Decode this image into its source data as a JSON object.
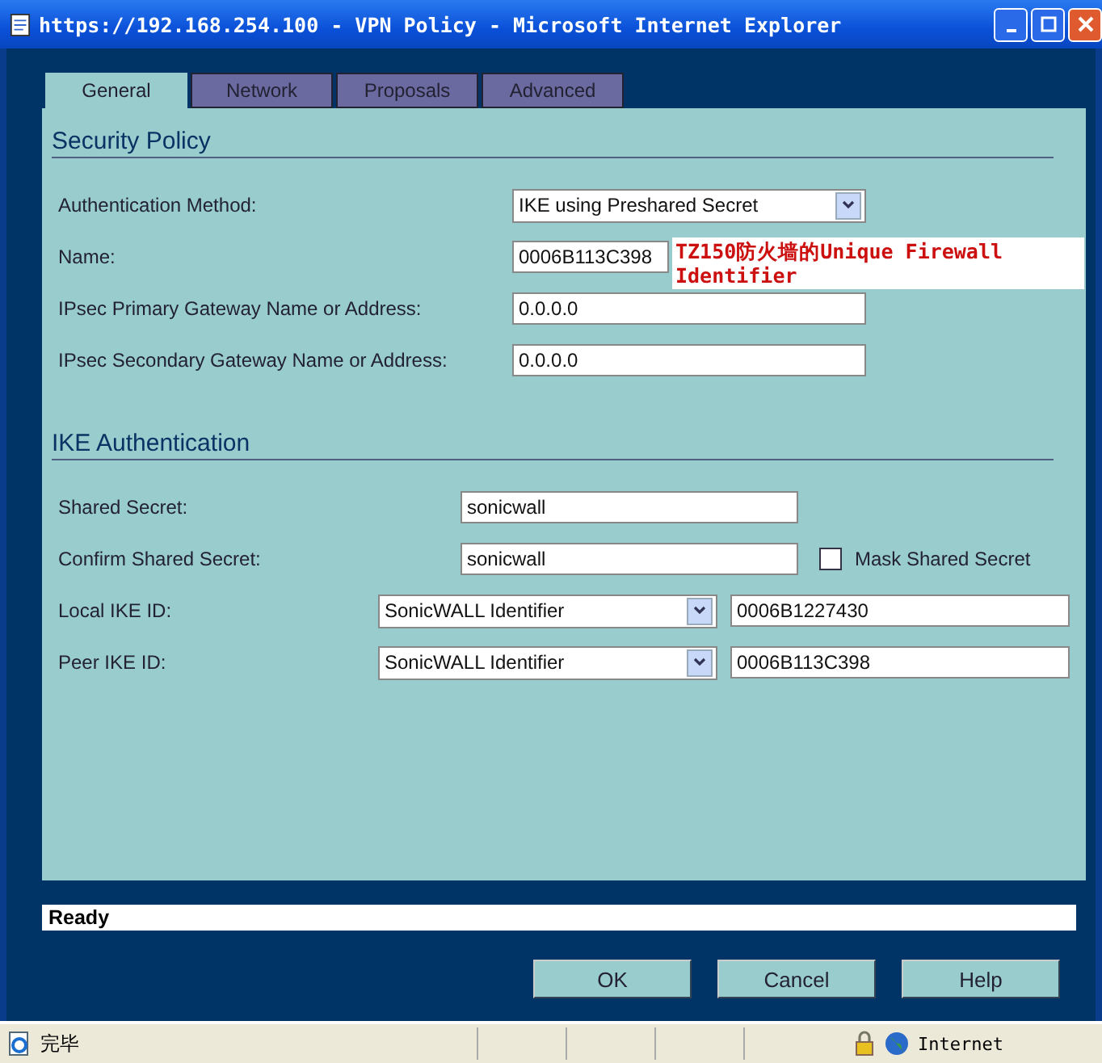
{
  "window": {
    "title": "https://192.168.254.100 - VPN Policy - Microsoft Internet Explorer"
  },
  "tabs": [
    {
      "label": "General",
      "selected": true
    },
    {
      "label": "Network",
      "selected": false
    },
    {
      "label": "Proposals",
      "selected": false
    },
    {
      "label": "Advanced",
      "selected": false
    }
  ],
  "sections": [
    {
      "title": "Security Policy",
      "fields": [
        {
          "kind": "select",
          "label": "Authentication Method:",
          "value": "IKE using Preshared Secret"
        },
        {
          "kind": "partial_input",
          "label": "Name:",
          "value": "0006B113C398"
        },
        {
          "kind": "input",
          "label": "IPsec Primary Gateway Name or Address:",
          "value": "0.0.0.0"
        },
        {
          "kind": "input",
          "label": "IPsec Secondary Gateway Name or Address:",
          "value": "0.0.0.0"
        }
      ]
    },
    {
      "title": "IKE Authentication",
      "fields": [
        {
          "kind": "secret",
          "label": "Shared Secret:",
          "value": "sonicwall"
        },
        {
          "kind": "secret_check",
          "label": "Confirm Shared Secret:",
          "value": "sonicwall",
          "checkbox": {
            "label": "Mask Shared Secret",
            "checked": false
          }
        },
        {
          "kind": "id",
          "label": "Local IKE ID:",
          "type": "SonicWALL Identifier",
          "value": "0006B1227430"
        },
        {
          "kind": "id",
          "label": "Peer IKE ID:",
          "type": "SonicWALL Identifier",
          "value": "0006B113C398"
        }
      ]
    }
  ],
  "annotation": "TZ150防火墙的Unique Firewall Identifier",
  "message": "Ready",
  "buttons": [
    "OK",
    "Cancel",
    "Help"
  ],
  "status_bar": {
    "text": "完毕",
    "zone": "Internet"
  }
}
